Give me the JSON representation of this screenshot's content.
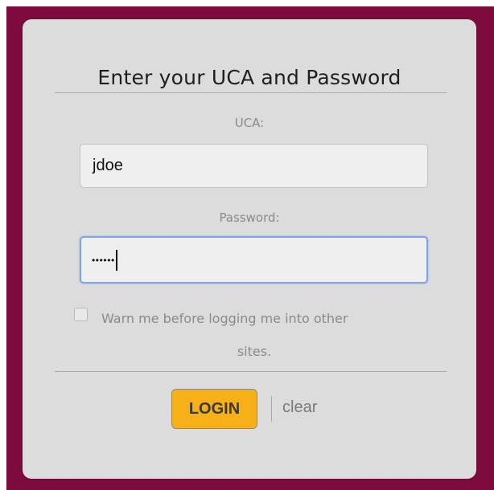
{
  "login_form": {
    "title": "Enter your UCA and Password",
    "uca_label": "UCA:",
    "uca_value": "jdoe",
    "password_label": "Password:",
    "password_mask": "••••••",
    "warn_line1": "Warn me before logging me into other",
    "warn_line2": "sites.",
    "warn_checked": false,
    "login_label": "LOGIN",
    "clear_label": "clear"
  },
  "colors": {
    "frame": "#7d0b3c",
    "panel": "#dcdcdc",
    "login_button": "#f7b018",
    "focus_border": "#7fa4e6"
  }
}
